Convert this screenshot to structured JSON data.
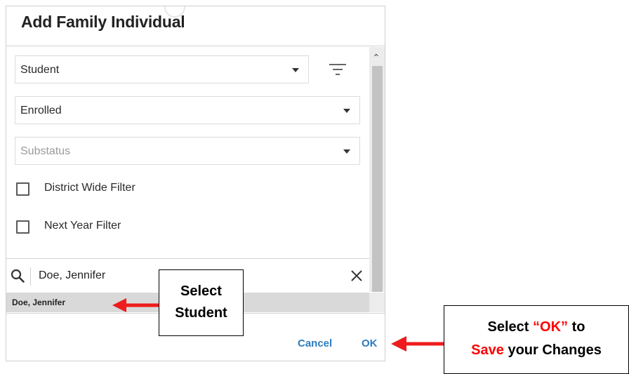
{
  "dialog": {
    "title": "Add Family Individual",
    "type_select": {
      "value": "Student"
    },
    "status_select": {
      "value": "Enrolled"
    },
    "substatus_select": {
      "placeholder": "Substatus"
    },
    "checkboxes": [
      {
        "label": "District Wide Filter",
        "checked": false
      },
      {
        "label": "Next Year Filter",
        "checked": false
      }
    ],
    "search": {
      "value": "Doe, Jennifer"
    },
    "results": [
      {
        "label": "Doe, Jennifer"
      }
    ],
    "buttons": {
      "cancel": "Cancel",
      "ok": "OK"
    }
  },
  "annotations": {
    "callout_student": {
      "line1": "Select",
      "line2": "Student"
    },
    "callout_ok": {
      "line1_pre": "Select",
      "line1_quote": "“OK”",
      "line1_post": "to",
      "line2_red": "Save",
      "line2_post": "your Changes"
    },
    "highlight_color": "#ff0000",
    "arrow_color": "#ee1c1c"
  },
  "colors": {
    "accent": "#2e7cc0"
  }
}
